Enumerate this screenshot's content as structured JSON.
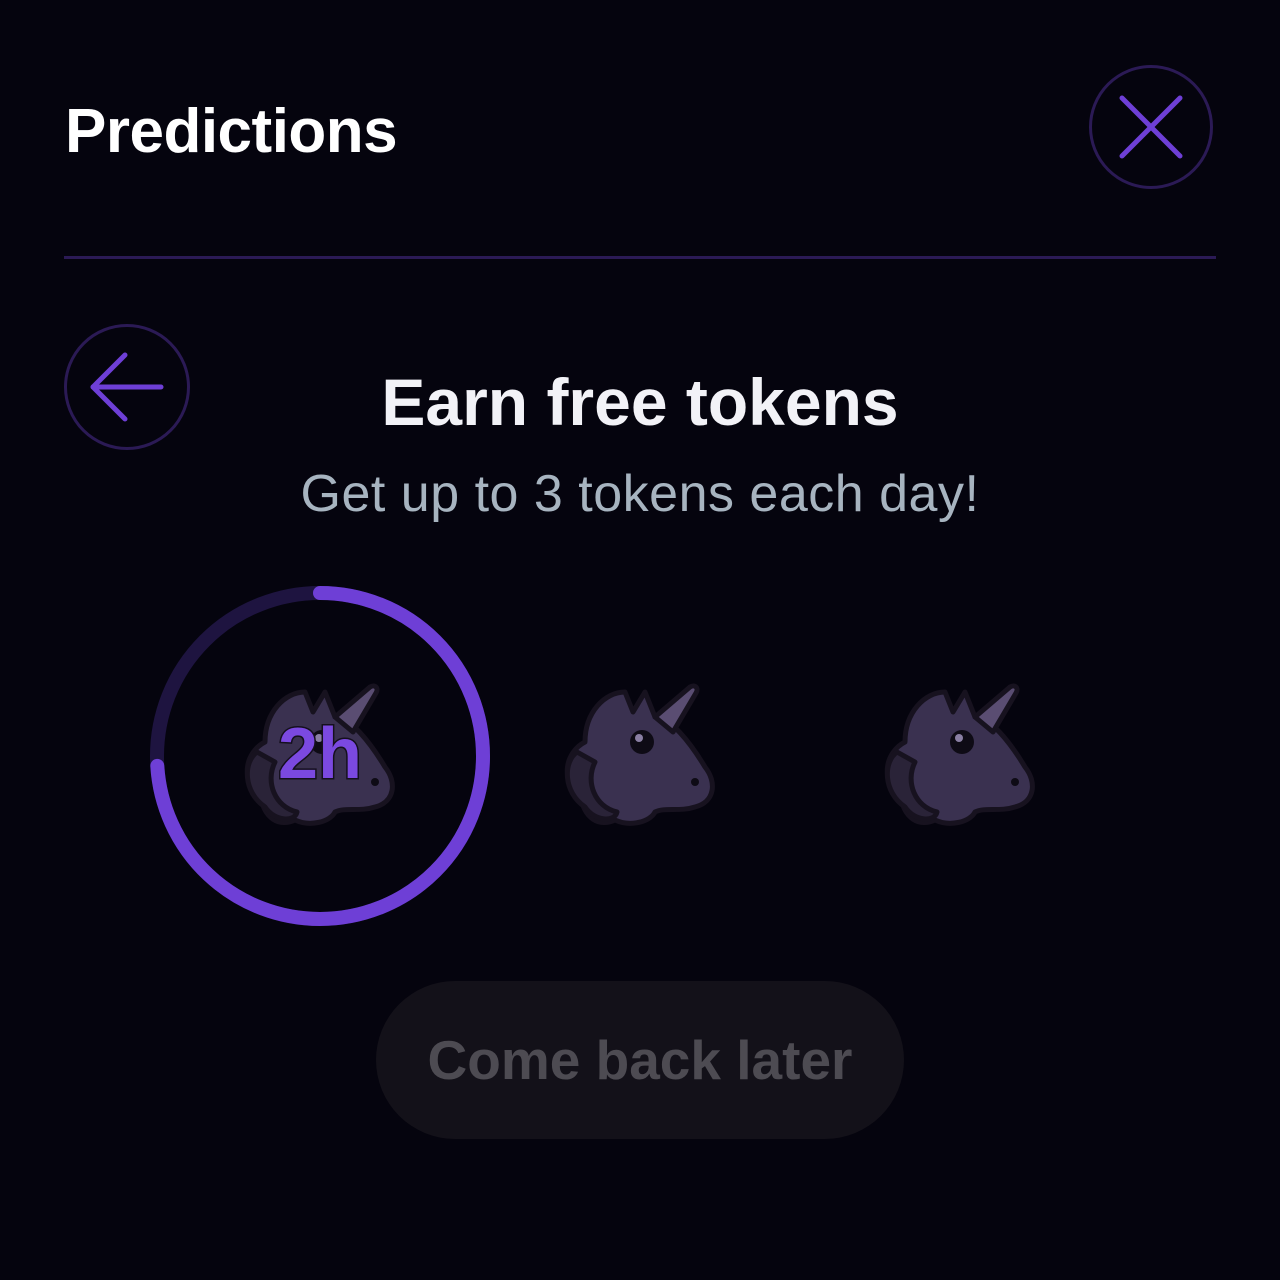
{
  "header": {
    "title": "Predictions",
    "close_icon": "close-icon"
  },
  "nav": {
    "back_icon": "arrow-left-icon"
  },
  "content": {
    "heading": "Earn free tokens",
    "subheading": "Get up to 3 tokens each day!"
  },
  "tokens": {
    "icon": "unicorn-icon",
    "count": 3,
    "timer_label": "2h",
    "timer_progress": 0.74
  },
  "action": {
    "label": "Come back later",
    "disabled": true
  },
  "colors": {
    "background": "#05040e",
    "accent": "#6e3fd6",
    "ring_track": "#1e1440",
    "border": "#2b1a55",
    "subtext": "#a7b4c0",
    "button_bg": "#131119",
    "button_text": "#4d4b52"
  }
}
